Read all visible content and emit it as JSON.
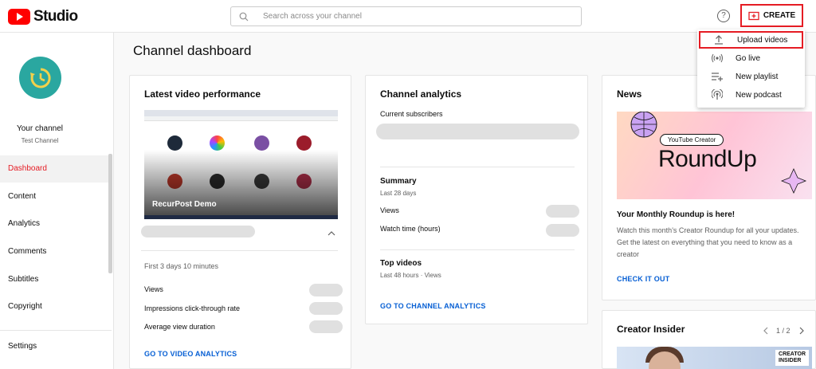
{
  "header": {
    "logo_text": "Studio",
    "search_placeholder": "Search across your channel",
    "help_label": "?",
    "create_label": "CREATE"
  },
  "create_menu": {
    "items": [
      {
        "label": "Upload videos",
        "icon": "upload-icon"
      },
      {
        "label": "Go live",
        "icon": "live-icon"
      },
      {
        "label": "New playlist",
        "icon": "playlist-add-icon"
      },
      {
        "label": "New podcast",
        "icon": "podcast-icon"
      }
    ]
  },
  "sidebar": {
    "your_channel": "Your channel",
    "channel_name": "Test Channel",
    "items": [
      {
        "label": "Dashboard",
        "active": true
      },
      {
        "label": "Content"
      },
      {
        "label": "Analytics"
      },
      {
        "label": "Comments"
      },
      {
        "label": "Subtitles"
      },
      {
        "label": "Copyright"
      },
      {
        "label": "Settings"
      }
    ]
  },
  "main": {
    "title": "Channel dashboard",
    "latest_video": {
      "title": "Latest video performance",
      "video_title": "RecurPost Demo",
      "period": "First 3 days 10 minutes",
      "metrics": [
        "Views",
        "Impressions click-through rate",
        "Average view duration"
      ],
      "link": "GO TO VIDEO ANALYTICS"
    },
    "analytics": {
      "title": "Channel analytics",
      "subscribers_label": "Current subscribers",
      "summary_title": "Summary",
      "summary_period": "Last 28 days",
      "summary_metrics": [
        "Views",
        "Watch time (hours)"
      ],
      "top_videos_title": "Top videos",
      "top_videos_period": "Last 48 hours · Views",
      "link": "GO TO CHANNEL ANALYTICS"
    },
    "news": {
      "title": "News",
      "chip": "YouTube Creator",
      "big_text": "RoundUp",
      "headline": "Your Monthly Roundup is here!",
      "body": "Watch this month's Creator Roundup for all your updates. Get the latest on everything that you need to know as a creator",
      "link": "CHECK IT OUT"
    },
    "creator_insider": {
      "title": "Creator Insider",
      "pager": "1 / 2",
      "badge_line1": "CREATOR",
      "badge_line2": "INSIDER"
    }
  },
  "colors": {
    "accent_red": "#e51c24",
    "link_blue": "#065fd4",
    "avatar_teal": "#2aa7a0"
  }
}
